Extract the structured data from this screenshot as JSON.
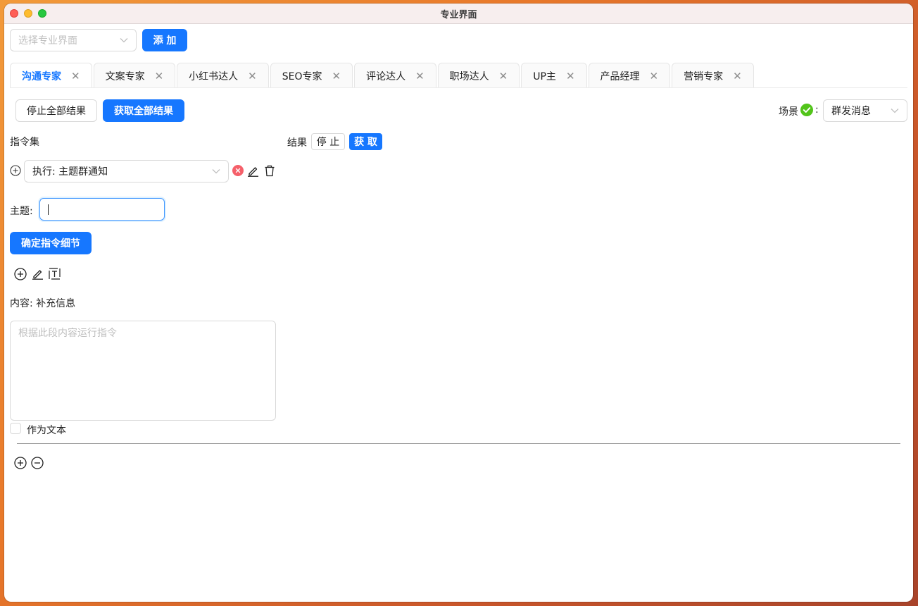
{
  "window": {
    "title": "专业界面"
  },
  "toolbar": {
    "select_placeholder": "选择专业界面",
    "add_label": "添 加"
  },
  "tabs": [
    {
      "label": "沟通专家",
      "active": true
    },
    {
      "label": "文案专家"
    },
    {
      "label": "小红书达人"
    },
    {
      "label": "SEO专家"
    },
    {
      "label": "评论达人"
    },
    {
      "label": "职场达人"
    },
    {
      "label": "UP主"
    },
    {
      "label": "产品经理"
    },
    {
      "label": "营销专家"
    }
  ],
  "actions": {
    "stop_all_label": "停止全部结果",
    "fetch_all_label": "获取全部结果",
    "scene_label": "场景",
    "scene_colon": ":",
    "scene_value": "群发消息"
  },
  "commands": {
    "heading": "指令集",
    "selected_command": "执行: 主题群通知",
    "topic_label": "主题:",
    "topic_value": "",
    "confirm_label": "确定指令细节",
    "content_label": "内容: 补充信息",
    "content_placeholder": "根据此段内容运行指令",
    "as_text_label": "作为文本"
  },
  "results": {
    "label": "结果",
    "stop_label": "停 止",
    "fetch_label": "获 取"
  },
  "colors": {
    "primary": "#1677ff",
    "success": "#52c41a",
    "danger": "#f5606a"
  }
}
